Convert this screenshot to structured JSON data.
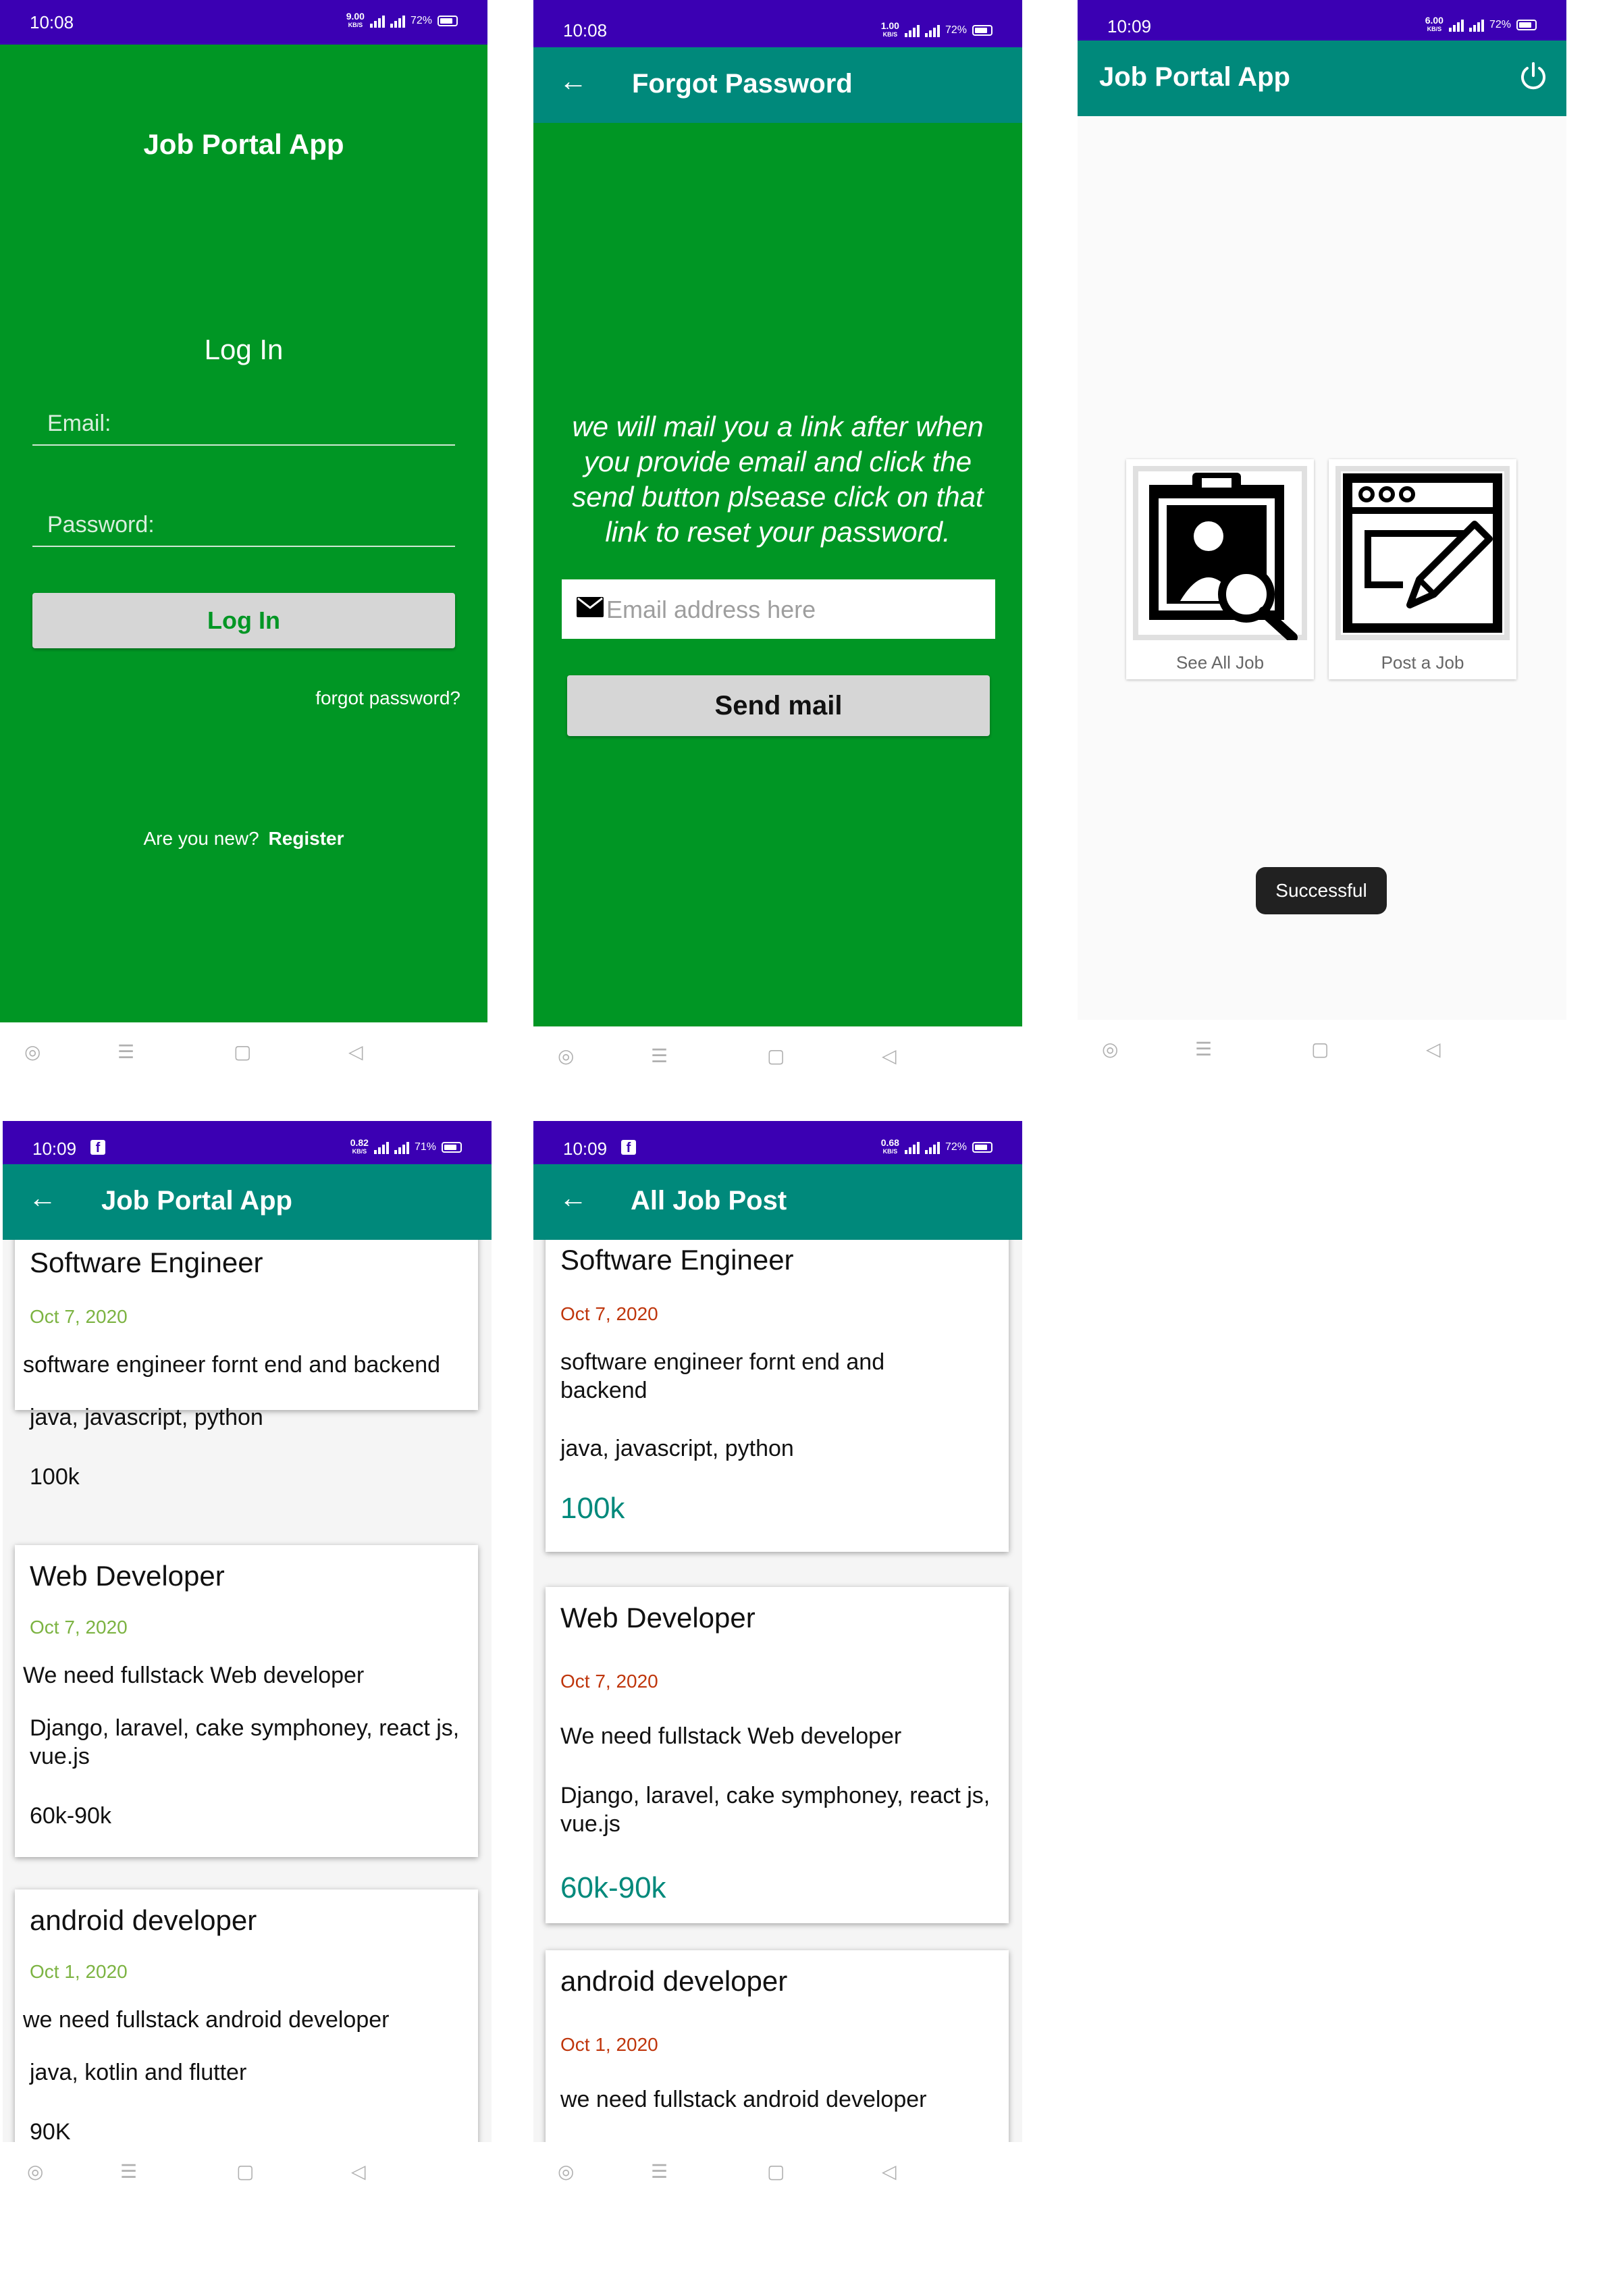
{
  "colors": {
    "status_bar": "#3b00b3",
    "green_bg": "#009624",
    "app_bar": "#00897b",
    "fab": "#e91e63",
    "date_green": "#7cb342",
    "date_orange": "#bf360c",
    "salary_teal": "#00897b"
  },
  "status": {
    "s1": {
      "time": "10:08",
      "speed": "9.00",
      "battery": "72%"
    },
    "s2": {
      "time": "10:08",
      "speed": "1.00",
      "battery": "72%"
    },
    "s3": {
      "time": "10:09",
      "speed": "6.00",
      "battery": "72%"
    },
    "s4": {
      "time": "10:09",
      "speed": "0.82",
      "battery": "71%"
    },
    "s5": {
      "time": "10:09",
      "speed": "0.68",
      "battery": "72%"
    },
    "speed_unit": "KB/S"
  },
  "login": {
    "app_title": "Job Portal App",
    "heading": "Log In",
    "email_label": "Email:",
    "password_label": "Password:",
    "login_button": "Log In",
    "forgot_link": "forgot password?",
    "new_text": "Are you new?",
    "register_link": "Register"
  },
  "forgot": {
    "title": "Forgot Password",
    "message": "we will mail you a link after when you provide email and click the send button plsease click on that link to reset your password.",
    "email_placeholder": "Email address here",
    "send_button": "Send mail"
  },
  "home": {
    "title": "Job Portal App",
    "power_icon": "power-icon",
    "see_all": "See All Job",
    "post_job": "Post a Job",
    "toast": "Successful"
  },
  "list": {
    "title": "Job Portal App",
    "fab_icon": "plus-icon",
    "jobs": [
      {
        "title": "Software Engineer",
        "date": "Oct 7, 2020",
        "desc": "software engineer fornt end and backend",
        "skills": "java, javascript, python",
        "salary": "100k"
      },
      {
        "title": "Web Developer",
        "date": "Oct 7, 2020",
        "desc": "We need fullstack Web developer",
        "skills": "Django, laravel, cake symphoney, react js, vue.js",
        "salary": "60k-90k"
      },
      {
        "title": "android developer",
        "date": "Oct 1, 2020",
        "desc": "we need fullstack android developer",
        "skills": "java, kotlin and flutter",
        "salary": "90K"
      }
    ]
  },
  "allposts": {
    "title": "All Job Post",
    "jobs": [
      {
        "title": "Software Engineer",
        "date": "Oct 7, 2020",
        "desc": "software engineer fornt end and backend",
        "skills": "java, javascript, python",
        "salary": "100k"
      },
      {
        "title": "Web Developer",
        "date": "Oct 7, 2020",
        "desc": "We need fullstack Web developer",
        "skills": "Django, laravel, cake symphoney, react js, vue.js",
        "salary": "60k-90k"
      },
      {
        "title": "android developer",
        "date": "Oct 1, 2020",
        "desc": "we need fullstack android developer"
      }
    ]
  },
  "nav_icons": [
    "assistant-icon",
    "menu-icon",
    "home-icon",
    "back-icon"
  ]
}
